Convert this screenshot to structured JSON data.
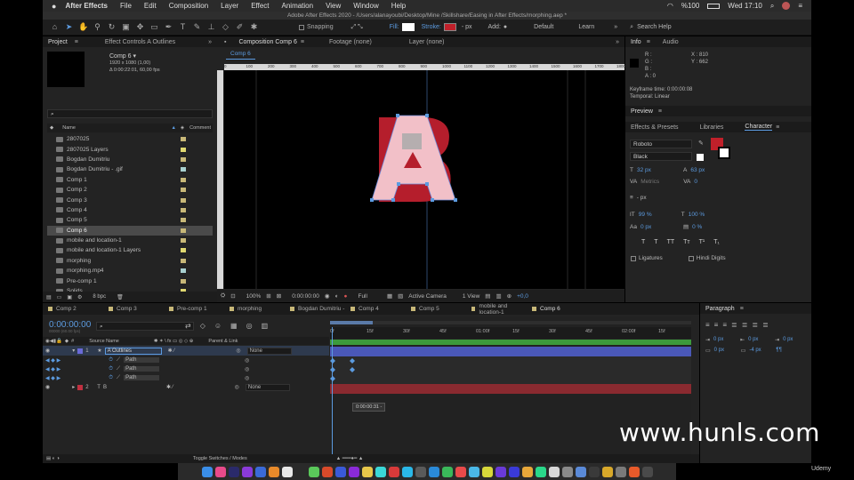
{
  "menubar": {
    "app": "After Effects",
    "items": [
      "File",
      "Edit",
      "Composition",
      "Layer",
      "Effect",
      "Animation",
      "View",
      "Window",
      "Help"
    ],
    "battery": "%100",
    "clock": "Wed 17:10"
  },
  "toolbar": {
    "snapping": "Snapping",
    "fill": "Fill:",
    "stroke": "Stroke:",
    "stroke_px": "- px",
    "add": "Add:",
    "workspaces": [
      "Default",
      "Learn"
    ],
    "search": "Search Help",
    "title": "Adobe After Effects 2020 - /Users/alanayoubi/Desktop/Mine /Skillshare/Easing in After Effects/morphing.aep *"
  },
  "project": {
    "tab": "Project",
    "effect_tab": "Effect Controls A Outlines",
    "thumb_name": "Comp 6 ▾",
    "thumb_info1": "1920 x 1080 (1,00)",
    "thumb_info2": "Δ 0:00:22:01, 60,00 fps",
    "col_name": "Name",
    "col_comment": "Comment",
    "bpc": "8 bpc",
    "items": [
      {
        "n": "2807025",
        "c": "#c8b878"
      },
      {
        "n": "2807025 Layers",
        "c": "#e0d870"
      },
      {
        "n": "Bogdan Dumitriu",
        "c": "#c8b878"
      },
      {
        "n": "Bogdan Dumitriu - .gif",
        "c": "#a8d0d0"
      },
      {
        "n": "Comp 1",
        "c": "#c8b878"
      },
      {
        "n": "Comp 2",
        "c": "#c8b878"
      },
      {
        "n": "Comp 3",
        "c": "#c8b878"
      },
      {
        "n": "Comp 4",
        "c": "#c8b878"
      },
      {
        "n": "Comp 5",
        "c": "#c8b878"
      },
      {
        "n": "Comp 6",
        "c": "#c8b878"
      },
      {
        "n": "mobile and location-1",
        "c": "#c8b878"
      },
      {
        "n": "mobile and location-1 Layers",
        "c": "#e0d870"
      },
      {
        "n": "morphing",
        "c": "#c8b878"
      },
      {
        "n": "morphing.mp4",
        "c": "#a8d0d0"
      },
      {
        "n": "Pre-comp 1",
        "c": "#c8b878"
      },
      {
        "n": "Solids",
        "c": "#e0d870"
      }
    ]
  },
  "viewer": {
    "tab": "Composition Comp 6",
    "footage": "Footage (none)",
    "layer": "Layer (none)",
    "comp_label": "Comp 6",
    "ruler": [
      "0",
      "100",
      "200",
      "300",
      "400",
      "500",
      "600",
      "700",
      "800",
      "900",
      "1000",
      "1100",
      "1200",
      "1300",
      "1400",
      "1500",
      "1600",
      "1700",
      "1800"
    ],
    "zoom": "100%",
    "time": "0:00:00:00",
    "quality": "Full",
    "camera": "Active Camera",
    "views": "1 View",
    "exposure": "+0,0"
  },
  "info": {
    "tab": "Info",
    "audio": "Audio",
    "r": "R :",
    "g": "G :",
    "b": "B :",
    "a": "A : 0",
    "x": "X : 810",
    "y": "Y : 662",
    "keyframe": "Keyframe time: 0:00:00:08",
    "temporal": "Temporal: Linear"
  },
  "preview": {
    "tab": "Preview"
  },
  "character": {
    "tabs": [
      "Effects & Presets",
      "Libraries",
      "Character"
    ],
    "font": "Roboto",
    "style": "Black",
    "size": "32 px",
    "leading": "63 px",
    "kerning": "Metrics",
    "tracking": "0",
    "stroke_w": "- px",
    "vscale": "99 %",
    "hscale": "100 %",
    "baseline": "0 px",
    "tsume": "0 %",
    "ligatures": "Ligatures",
    "hindi": "Hindi Digits",
    "fill_color": "#c0202a"
  },
  "paragraph": {
    "tab": "Paragraph",
    "v1": "0 px",
    "v2": "0 px",
    "v3": "0 px",
    "v4": "0 px",
    "v5": "-4 px",
    "v6": "0 px"
  },
  "timeline": {
    "tabs": [
      "Comp 2",
      "Comp 3",
      "Pre-comp 1",
      "morphing",
      "Bogdan Dumitriu -",
      "Comp 4",
      "Comp 5",
      "mobile and location-1",
      "Comp 6"
    ],
    "time": "0:00:00:00",
    "fps": "00000 (60.00 fps)",
    "cols": {
      "src": "Source Name",
      "parent": "Parent & Link"
    },
    "layers": [
      {
        "num": "1",
        "name": "A Outlines",
        "parent": "None",
        "color": "#6a6ad8"
      },
      {
        "num": "2",
        "name": "B",
        "parent": "None",
        "color": "#c03040"
      }
    ],
    "paths": [
      "Path",
      "Path",
      "Path"
    ],
    "ruler": [
      "0f",
      "15f",
      "30f",
      "45f",
      "01:00f",
      "15f",
      "30f",
      "45f",
      "02:00f",
      "15f"
    ],
    "tooltip": "0:00:00:31 -",
    "toggle": "Toggle Switches / Modes"
  },
  "watermark": "www.hunls.com",
  "udemy": "Udemy"
}
